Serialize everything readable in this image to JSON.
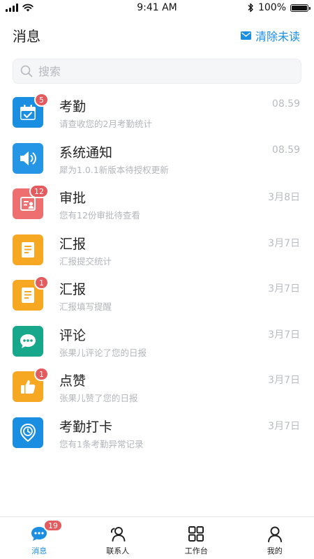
{
  "status_bar": {
    "time": "9:41 AM",
    "battery": "100%"
  },
  "header": {
    "title": "消息",
    "clear_label": "清除未读"
  },
  "search": {
    "placeholder": "搜索"
  },
  "colors": {
    "accent": "#1a8ee1",
    "badge": "#e35a5f"
  },
  "messages": [
    {
      "title": "考勤",
      "subtitle": "请查收您的2月考勤统计",
      "time": "08.59",
      "badge": "5",
      "icon": "calendar-check-icon",
      "color": "#1a8ee1"
    },
    {
      "title": "系统通知",
      "subtitle": "犀为1.0.1新版本待授权更新",
      "time": "08.59",
      "badge": "",
      "icon": "speaker-icon",
      "color": "#2596e6"
    },
    {
      "title": "审批",
      "subtitle": "您有12份审批待查看",
      "time": "3月8日",
      "badge": "12",
      "icon": "approval-card-icon",
      "color": "#ee6f6f"
    },
    {
      "title": "汇报",
      "subtitle": "汇报提交统计",
      "time": "3月7日",
      "badge": "",
      "icon": "report-document-icon",
      "color": "#f7a823"
    },
    {
      "title": "汇报",
      "subtitle": "汇报填写提醒",
      "time": "3月7日",
      "badge": "1",
      "icon": "report-document-icon",
      "color": "#f7a823"
    },
    {
      "title": "评论",
      "subtitle": "张果儿评论了您的日报",
      "time": "3月7日",
      "badge": "",
      "icon": "comment-bubble-icon",
      "color": "#17a88c"
    },
    {
      "title": "点赞",
      "subtitle": "张果儿赞了您的日报",
      "time": "3月7日",
      "badge": "1",
      "icon": "thumbs-up-icon",
      "color": "#f7a823"
    },
    {
      "title": "考勤打卡",
      "subtitle": "您有1条考勤异常记录",
      "time": "3月7日",
      "badge": "",
      "icon": "location-clock-icon",
      "color": "#1a8ee1"
    }
  ],
  "tabbar": {
    "messages_label": "消息",
    "messages_badge": "19",
    "contacts_label": "联系人",
    "workbench_label": "工作台",
    "mine_label": "我的"
  }
}
